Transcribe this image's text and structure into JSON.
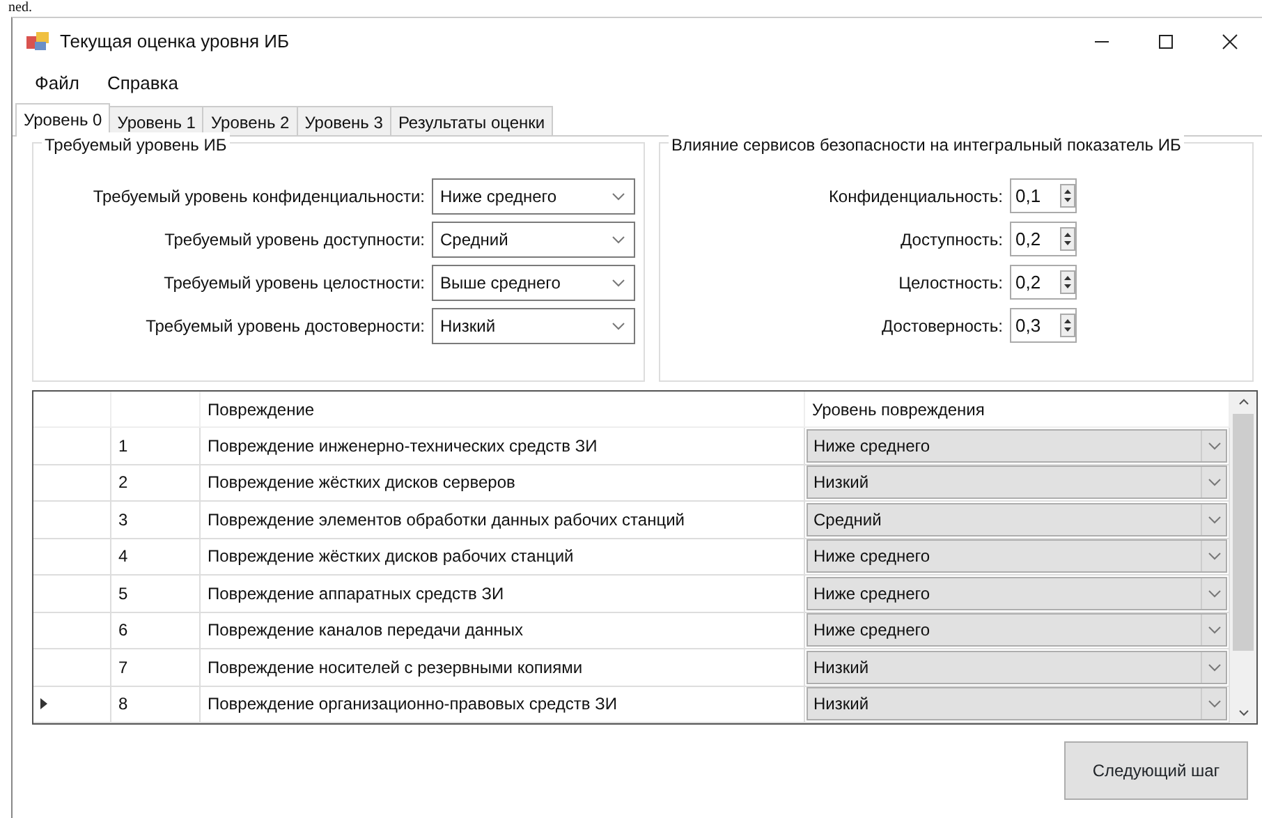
{
  "doc_fragment": "ned.",
  "window": {
    "title": "Текущая оценка уровня ИБ"
  },
  "menu": [
    "Файл",
    "Справка"
  ],
  "tabs": [
    {
      "label": "Уровень 0",
      "selected": true
    },
    {
      "label": "Уровень 1",
      "selected": false
    },
    {
      "label": "Уровень 2",
      "selected": false
    },
    {
      "label": "Уровень 3",
      "selected": false
    },
    {
      "label": "Результаты оценки",
      "selected": false
    }
  ],
  "required_group": {
    "title": "Требуемый уровень ИБ",
    "fields": [
      {
        "label": "Требуемый уровень конфиденциальности:",
        "value": "Ниже среднего"
      },
      {
        "label": "Требуемый уровень доступности:",
        "value": "Средний"
      },
      {
        "label": "Требуемый уровень целостности:",
        "value": "Выше среднего"
      },
      {
        "label": "Требуемый уровень достоверности:",
        "value": "Низкий"
      }
    ]
  },
  "influence_group": {
    "title": "Влияние сервисов безопасности на интегральный показатель ИБ",
    "fields": [
      {
        "label": "Конфиденциальность:",
        "value": "0,1"
      },
      {
        "label": "Доступность:",
        "value": "0,2"
      },
      {
        "label": "Целостность:",
        "value": "0,2"
      },
      {
        "label": "Достоверность:",
        "value": "0,3"
      }
    ]
  },
  "table": {
    "columns": [
      "Повреждение",
      "Уровень повреждения"
    ],
    "rows": [
      {
        "number": "1",
        "damage": "Повреждение инженерно-технических средств ЗИ",
        "level": "Ниже среднего",
        "current": false
      },
      {
        "number": "2",
        "damage": "Повреждение жёстких дисков серверов",
        "level": "Низкий",
        "current": false
      },
      {
        "number": "3",
        "damage": "Повреждение элементов обработки данных рабочих станций",
        "level": "Средний",
        "current": false
      },
      {
        "number": "4",
        "damage": "Повреждение жёстких дисков рабочих станций",
        "level": "Ниже среднего",
        "current": false
      },
      {
        "number": "5",
        "damage": "Повреждение аппаратных средств ЗИ",
        "level": "Ниже среднего",
        "current": false
      },
      {
        "number": "6",
        "damage": "Повреждение каналов передачи данных",
        "level": "Ниже среднего",
        "current": false
      },
      {
        "number": "7",
        "damage": "Повреждение носителей с резервными копиями",
        "level": "Низкий",
        "current": false
      },
      {
        "number": "8",
        "damage": "Повреждение организационно-правовых средств ЗИ",
        "level": "Низкий",
        "current": true
      }
    ]
  },
  "next_button": "Следующий шаг"
}
